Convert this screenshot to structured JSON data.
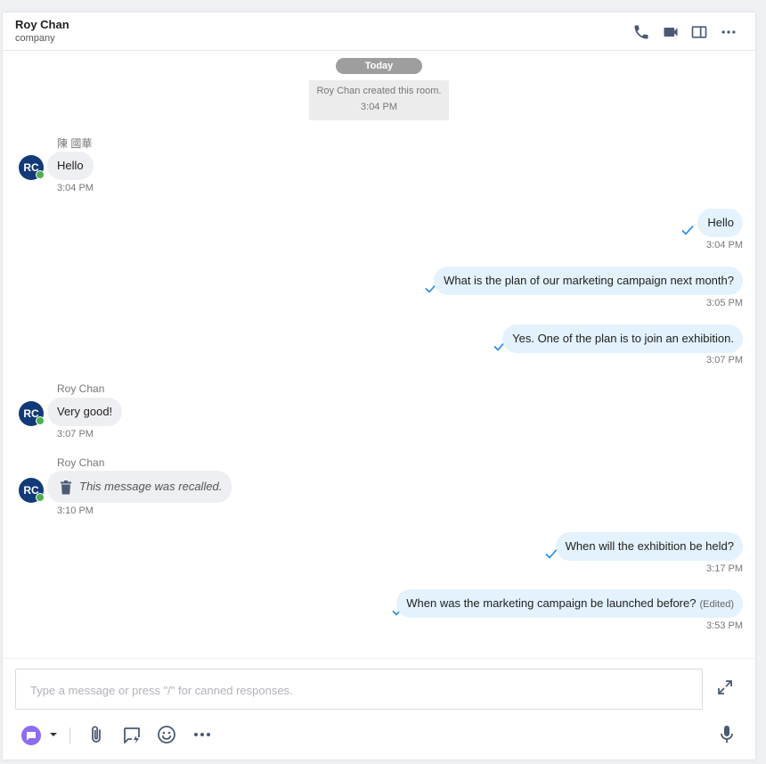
{
  "header": {
    "title": "Roy Chan",
    "subtitle": "company",
    "icons": [
      "phone-icon",
      "video-icon",
      "side-panel-icon",
      "more-icon"
    ]
  },
  "date_divider": "Today",
  "system_note": {
    "text": "Roy Chan created this room.",
    "time": "3:04 PM"
  },
  "messages": [
    {
      "dir": "in",
      "sender": "陳 國華",
      "avatar": "RC",
      "text": "Hello",
      "time": "3:04 PM"
    },
    {
      "dir": "out",
      "text": "Hello",
      "time": "3:04 PM",
      "status": "sent"
    },
    {
      "dir": "out",
      "text": "What is the plan of our marketing campaign next month?",
      "time": "3:05 PM",
      "status": "sent"
    },
    {
      "dir": "out",
      "text": "Yes. One of the plan is to join an exhibition.",
      "time": "3:07 PM",
      "status": "sent"
    },
    {
      "dir": "in",
      "sender": "Roy Chan",
      "avatar": "RC",
      "text": "Very good!",
      "time": "3:07 PM"
    },
    {
      "dir": "in",
      "sender": "Roy Chan",
      "avatar": "RC",
      "text": "This message was recalled.",
      "time": "3:10 PM",
      "recalled": true
    },
    {
      "dir": "out",
      "text": "When will the exhibition be held?",
      "time": "3:17 PM",
      "status": "sent"
    },
    {
      "dir": "out",
      "text": "When was the marketing campaign be launched before?",
      "edited_tag": "(Edited)",
      "time": "3:53 PM",
      "status": "sent"
    }
  ],
  "composer": {
    "placeholder": "Type a message or press \"/\" for canned responses.",
    "value": "",
    "toolbar": [
      "message-type-icon",
      "dropdown-caret-icon",
      "attachment-icon",
      "quick-reply-icon",
      "emoji-icon",
      "more-icon",
      "microphone-icon",
      "expand-icon"
    ]
  },
  "colors": {
    "avatar": "#123a78",
    "online": "#4caf50",
    "incoming_bubble": "#eeeff2",
    "outgoing_bubble": "#e3f2fd",
    "check": "#1e88e5",
    "accent_purple": "#8e6cf0",
    "icon_grey": "#4a5a73"
  }
}
